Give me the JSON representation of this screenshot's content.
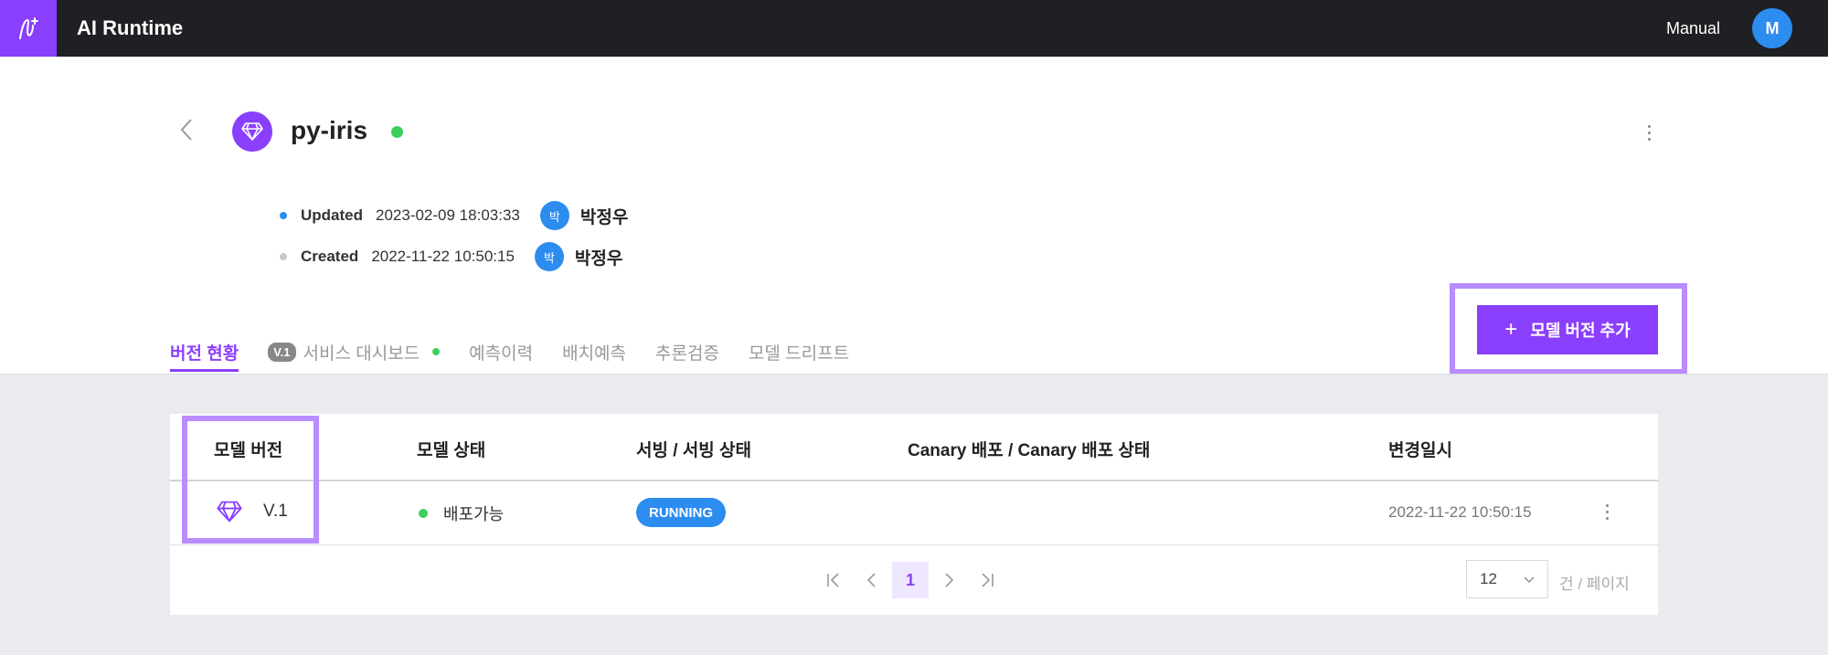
{
  "app": {
    "title": "AI Runtime",
    "user_name": "Manual",
    "user_initial": "M"
  },
  "model": {
    "name": "py-iris",
    "status_color": "#3ccf5c"
  },
  "meta": {
    "updated": {
      "label": "Updated",
      "timestamp": "2023-02-09 18:03:33",
      "avatar": "박",
      "user": "박정우",
      "dot_color": "#2d8cf0"
    },
    "created": {
      "label": "Created",
      "timestamp": "2022-11-22 10:50:15",
      "avatar": "박",
      "user": "박정우",
      "dot_color": "#c8c8c8"
    }
  },
  "tabs": [
    {
      "label": "버전 현황",
      "active": true
    },
    {
      "badge": "V.1",
      "label": "서비스 대시보드",
      "dot": true
    },
    {
      "label": "예측이력"
    },
    {
      "label": "배치예측"
    },
    {
      "label": "추론검증"
    },
    {
      "label": "모델 드리프트"
    }
  ],
  "add_button": {
    "label": "모델 버전 추가"
  },
  "table": {
    "headers": [
      "모델 버전",
      "모델 상태",
      "서빙 / 서빙 상태",
      "Canary 배포 / Canary 배포 상태",
      "변경일시"
    ],
    "rows": [
      {
        "version": "V.1",
        "status": "배포가능",
        "serving": "RUNNING",
        "canary": "",
        "changed": "2022-11-22 10:50:15"
      }
    ]
  },
  "pagination": {
    "current_page": "1",
    "per_page": "12",
    "per_page_label": "건 / 페이지"
  },
  "colors": {
    "brand": "#8a3ffc",
    "topbar": "#1f2023",
    "accent_blue": "#2d8cf0",
    "highlight": "#b98cff"
  }
}
